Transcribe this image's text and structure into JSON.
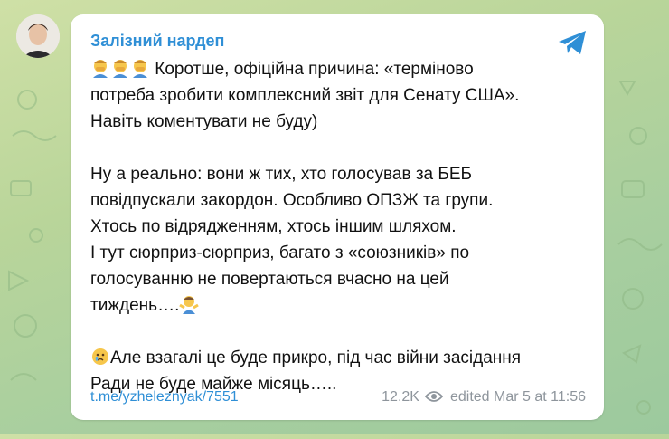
{
  "channel": {
    "name": "Залізний нардеп"
  },
  "message": {
    "line1_text": " Коротше, офіційна причина: «терміново",
    "line2": "потреба зробити комплексний звіт для Сенату США».",
    "line3": "Навіть коментувати не буду)",
    "line4": "Ну а реально: вони ж тих, хто голосував за БЕБ",
    "line5": "повідпускали закордон. Особливо ОПЗЖ та групи.",
    "line6": "Хтось по відрядженням, хтось іншим шляхом.",
    "line7": "І тут сюрприз-сюрприз, багато з «союзників» по",
    "line8": "голосуванню не повертаються вчасно на цей",
    "line9_text": "тиждень….",
    "line10_text": "Але взагалі це буде прикро, під час війни засідання",
    "line11": "Ради не буде майже місяць….."
  },
  "footer": {
    "link": "t.me/yzheleznyak/7551",
    "views": "12.2K",
    "edited_label": "edited",
    "date": "Mar 5 at 11:56"
  },
  "icons": {
    "share": "telegram-share-icon",
    "eye": "eye-icon",
    "emoji_facepalm": "man-facepalming-emoji",
    "emoji_shrug": "man-shrugging-emoji",
    "emoji_cry": "crying-face-emoji"
  },
  "colors": {
    "accent": "#2f8fd6",
    "meta": "#8e959c",
    "bubble": "#ffffff",
    "wallpaper": "#b9d59a"
  }
}
